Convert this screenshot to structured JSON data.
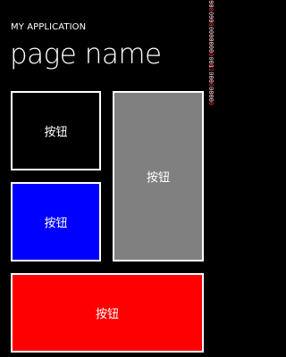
{
  "header": {
    "app_title": "MY APPLICATION",
    "page_title": "page name"
  },
  "buttons": [
    {
      "label": "按钮",
      "color": "#000000"
    },
    {
      "label": "按钮",
      "color": "#0000ff"
    },
    {
      "label": "按钮",
      "color": "#808080"
    },
    {
      "label": "按钮",
      "color": "#ff0000"
    }
  ],
  "debug_counters": {
    "line1": "090 090 0000000 001 000 0000",
    "line2": "090 090 0000000 001 000 0000"
  },
  "colors": {
    "background": "#000000",
    "text": "#ffffff",
    "border": "#ffffff"
  }
}
